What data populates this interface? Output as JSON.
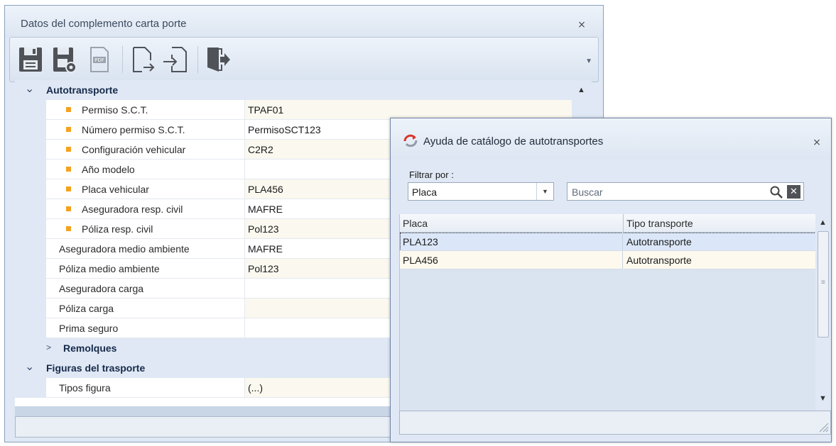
{
  "main_window": {
    "title": "Datos del complemento carta porte",
    "toolbar": {
      "icons": [
        "save-icon",
        "save-settings-icon",
        "pdf-icon",
        "export-document-icon",
        "import-document-icon",
        "exit-icon"
      ]
    },
    "property_grid": {
      "category_autotransporte": "Autotransporte",
      "rows": [
        {
          "label": "Permiso S.C.T.",
          "value": "TPAF01",
          "required": true
        },
        {
          "label": "Número permiso S.C.T.",
          "value": "PermisoSCT123",
          "required": true
        },
        {
          "label": "Configuración vehicular",
          "value": "C2R2",
          "required": true
        },
        {
          "label": "Año modelo",
          "value": "",
          "required": true
        },
        {
          "label": "Placa vehicular",
          "value": "PLA456",
          "required": true
        },
        {
          "label": "Aseguradora resp. civil",
          "value": "MAFRE",
          "required": true
        },
        {
          "label": "Póliza resp. civil",
          "value": "Pol123",
          "required": true
        },
        {
          "label": "Aseguradora medio ambiente",
          "value": "MAFRE",
          "required": false
        },
        {
          "label": "Póliza medio ambiente",
          "value": "Pol123",
          "required": false
        },
        {
          "label": "Aseguradora carga",
          "value": "",
          "required": false
        },
        {
          "label": "Póliza carga",
          "value": "",
          "required": false
        },
        {
          "label": "Prima seguro",
          "value": "",
          "required": false
        }
      ],
      "subcategory_remolques": "Remolques",
      "category_figuras": "Figuras del trasporte",
      "figuras_rows": [
        {
          "label": "Tipos figura",
          "value": "(...)"
        }
      ]
    }
  },
  "dialog": {
    "title": "Ayuda de catálogo de  autotransportes",
    "filter_label": "Filtrar por :",
    "filter_value": "Placa",
    "search_placeholder": "Buscar",
    "columns": [
      "Placa",
      "Tipo transporte"
    ],
    "rows": [
      {
        "placa": "PLA123",
        "tipo": "Autotransporte"
      },
      {
        "placa": "PLA456",
        "tipo": "Autotransporte"
      }
    ]
  },
  "colors": {
    "required_marker": "#f4a21e",
    "window_bg": "#dfe8f4",
    "selected_row": "#dbe7f8",
    "alt_row": "#fdf9ee"
  }
}
